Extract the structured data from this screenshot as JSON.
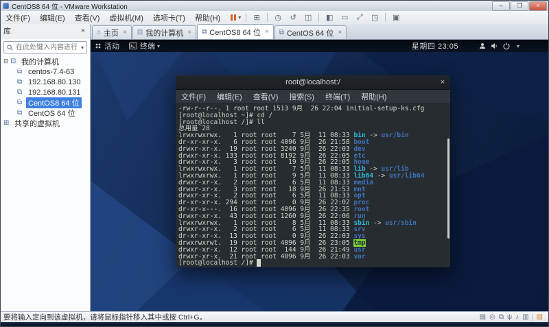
{
  "window": {
    "title": "CentOS8 64 位 - VMware Workstation",
    "controls": {
      "minimize": "–",
      "maximize": "❐",
      "close": "×"
    }
  },
  "menubar": {
    "items": [
      {
        "id": "file",
        "label": "文件(F)"
      },
      {
        "id": "edit",
        "label": "编辑(E)"
      },
      {
        "id": "view",
        "label": "查看(V)"
      },
      {
        "id": "vm",
        "label": "虚拟机(M)"
      },
      {
        "id": "tab",
        "label": "选项卡(T)"
      },
      {
        "id": "help",
        "label": "帮助(H)"
      }
    ]
  },
  "toolbar": {
    "icons": [
      {
        "id": "power-button",
        "glyph": "pause-bars",
        "dropdown": true
      },
      {
        "sep": true
      },
      {
        "id": "ctrl-alt-del-icon",
        "glyph": "⊞"
      },
      {
        "sep": true
      },
      {
        "id": "take-snapshot-icon",
        "glyph": "◷"
      },
      {
        "id": "revert-snapshot-icon",
        "glyph": "↺"
      },
      {
        "id": "manage-snapshots-icon",
        "glyph": "◫"
      },
      {
        "sep": true
      },
      {
        "id": "show-library-icon",
        "glyph": "◧"
      },
      {
        "id": "show-thumbnails-icon",
        "glyph": "▭"
      },
      {
        "id": "fullscreen-icon",
        "glyph": "⤢"
      },
      {
        "id": "unity-icon",
        "glyph": "◳"
      },
      {
        "sep": true
      },
      {
        "id": "console-view-icon",
        "glyph": "▣"
      }
    ]
  },
  "tabs": {
    "items": [
      {
        "id": "home",
        "label": "主页",
        "icon": "home",
        "active": false
      },
      {
        "id": "my-computer",
        "label": "我的计算机",
        "icon": "computer",
        "active": false
      },
      {
        "id": "centos8-64",
        "label": "CentOS8 64 位",
        "icon": "vm",
        "active": true
      },
      {
        "id": "centos-64",
        "label": "CentOS 64 位",
        "icon": "vm",
        "active": false
      }
    ]
  },
  "sidebar": {
    "header": "库",
    "search_placeholder": "在此处键入内容进行...",
    "tree": [
      {
        "id": "my-computer",
        "label": "我的计算机",
        "level": 0,
        "icon": "computer",
        "expander": "⊟"
      },
      {
        "id": "centos-7-4-63",
        "label": "centos-7.4-63",
        "level": 1,
        "icon": "vm"
      },
      {
        "id": "192-168-80-130",
        "label": "192.168.80.130",
        "level": 1,
        "icon": "vm"
      },
      {
        "id": "192-168-80-131",
        "label": "192.168.80.131",
        "level": 1,
        "icon": "vm"
      },
      {
        "id": "centos8-64",
        "label": "CentOS8 64 位",
        "level": 1,
        "icon": "vm",
        "selected": true
      },
      {
        "id": "centos-64",
        "label": "CentOS 64 位",
        "level": 1,
        "icon": "vm"
      },
      {
        "id": "shared-vms",
        "label": "共享的虚拟机",
        "level": 0,
        "icon": "shared"
      }
    ]
  },
  "vm": {
    "gnome_bar": {
      "activities": "活动",
      "app_menu": "终端",
      "clock": "星期四 23:05"
    },
    "terminal": {
      "title": "root@localhost:/",
      "menus": [
        {
          "id": "file",
          "label": "文件(F)"
        },
        {
          "id": "edit",
          "label": "编辑(E)"
        },
        {
          "id": "view",
          "label": "查看(V)"
        },
        {
          "id": "search",
          "label": "搜索(S)"
        },
        {
          "id": "terminal",
          "label": "终端(T)"
        },
        {
          "id": "help",
          "label": "帮助(H)"
        }
      ],
      "palette": {
        "background": "#272c31",
        "foreground": "#d3d7cf",
        "directory": "#3f72b8",
        "symlink": "#2eb8d8",
        "tmp_bg": "#7ecf31"
      },
      "lines": [
        [
          [
            "-rw-r--r--. 1 root root 1513 9月  26 22:04 initial-setup-ks.cfg",
            "fg"
          ]
        ],
        [
          [
            "[root@localhost ~]# cd /",
            "fg"
          ]
        ],
        [
          [
            "[root@localhost /]# ll",
            "fg"
          ]
        ],
        [
          [
            "总用量 28",
            "fg"
          ]
        ],
        [
          [
            "lrwxrwxrwx.   1 root root    7 5月  11 08:33 ",
            "fg"
          ],
          [
            "bin",
            "link"
          ],
          [
            " -> ",
            "fg"
          ],
          [
            "usr/bin",
            "dir"
          ]
        ],
        [
          [
            "dr-xr-xr-x.   6 root root 4096 9月  26 21:58 ",
            "fg"
          ],
          [
            "boot",
            "dir"
          ]
        ],
        [
          [
            "drwxr-xr-x.  19 root root 3240 9月  26 22:03 ",
            "fg"
          ],
          [
            "dev",
            "dir"
          ]
        ],
        [
          [
            "drwxr-xr-x. 133 root root 8192 9月  26 22:05 ",
            "fg"
          ],
          [
            "etc",
            "dir"
          ]
        ],
        [
          [
            "drwxr-xr-x.   3 root root   19 9月  26 22:05 ",
            "fg"
          ],
          [
            "home",
            "dir"
          ]
        ],
        [
          [
            "lrwxrwxrwx.   1 root root    7 5月  11 08:33 ",
            "fg"
          ],
          [
            "lib",
            "link"
          ],
          [
            " -> ",
            "fg"
          ],
          [
            "usr/lib",
            "dir"
          ]
        ],
        [
          [
            "lrwxrwxrwx.   1 root root    9 5月  11 08:33 ",
            "fg"
          ],
          [
            "lib64",
            "link"
          ],
          [
            " -> ",
            "fg"
          ],
          [
            "usr/lib64",
            "dir"
          ]
        ],
        [
          [
            "drwxr-xr-x.   2 root root    6 5月  11 08:33 ",
            "fg"
          ],
          [
            "media",
            "dir"
          ]
        ],
        [
          [
            "drwxr-xr-x.   3 root root   18 9月  26 21:53 ",
            "fg"
          ],
          [
            "mnt",
            "dir"
          ]
        ],
        [
          [
            "drwxr-xr-x.   2 root root    6 5月  11 08:33 ",
            "fg"
          ],
          [
            "opt",
            "dir"
          ]
        ],
        [
          [
            "dr-xr-xr-x. 294 root root    0 9月  26 22:02 ",
            "fg"
          ],
          [
            "proc",
            "dir"
          ]
        ],
        [
          [
            "dr-xr-x---.  16 root root 4096 9月  26 22:35 ",
            "fg"
          ],
          [
            "root",
            "dir"
          ]
        ],
        [
          [
            "drwxr-xr-x.  43 root root 1260 9月  26 22:06 ",
            "fg"
          ],
          [
            "run",
            "dir"
          ]
        ],
        [
          [
            "lrwxrwxrwx.   1 root root    8 5月  11 08:33 ",
            "fg"
          ],
          [
            "sbin",
            "link"
          ],
          [
            " -> ",
            "fg"
          ],
          [
            "usr/sbin",
            "dir"
          ]
        ],
        [
          [
            "drwxr-xr-x.   2 root root    6 5月  11 08:33 ",
            "fg"
          ],
          [
            "srv",
            "dir"
          ]
        ],
        [
          [
            "dr-xr-xr-x.  13 root root    0 9月  26 22:03 ",
            "fg"
          ],
          [
            "sys",
            "dir"
          ]
        ],
        [
          [
            "drwxrwxrwt.  19 root root 4096 9月  26 23:05 ",
            "fg"
          ],
          [
            "tmp",
            "tmp"
          ]
        ],
        [
          [
            "drwxr-xr-x.  12 root root  144 9月  26 21:49 ",
            "fg"
          ],
          [
            "usr",
            "dir"
          ]
        ],
        [
          [
            "drwxr-xr-x.  21 root root 4096 9月  26 22:03 ",
            "fg"
          ],
          [
            "var",
            "dir"
          ]
        ],
        [
          [
            "[root@localhost /]# ",
            "fg"
          ],
          [
            " ",
            "cursor"
          ]
        ]
      ]
    }
  },
  "statusbar": {
    "message": "要将输入定向到该虚拟机，请将鼠标指针移入其中或按 Ctrl+G。",
    "devices": [
      {
        "id": "hard-disk-icon",
        "glyph": "▤"
      },
      {
        "id": "cd-rom-icon",
        "glyph": "◎"
      },
      {
        "id": "network-adapter-icon",
        "glyph": "⧉"
      },
      {
        "id": "usb-icon",
        "glyph": "ψ"
      },
      {
        "id": "sound-icon",
        "glyph": "♪"
      },
      {
        "id": "printer-icon",
        "glyph": "▥"
      },
      {
        "sep": true
      },
      {
        "id": "message-alert-icon",
        "glyph": "▨",
        "alert": true
      }
    ]
  },
  "icons": {
    "close": "×",
    "caret": "▾",
    "home": "⌂",
    "computer": "⊡",
    "vm": "⧉",
    "shared": "⊞"
  }
}
